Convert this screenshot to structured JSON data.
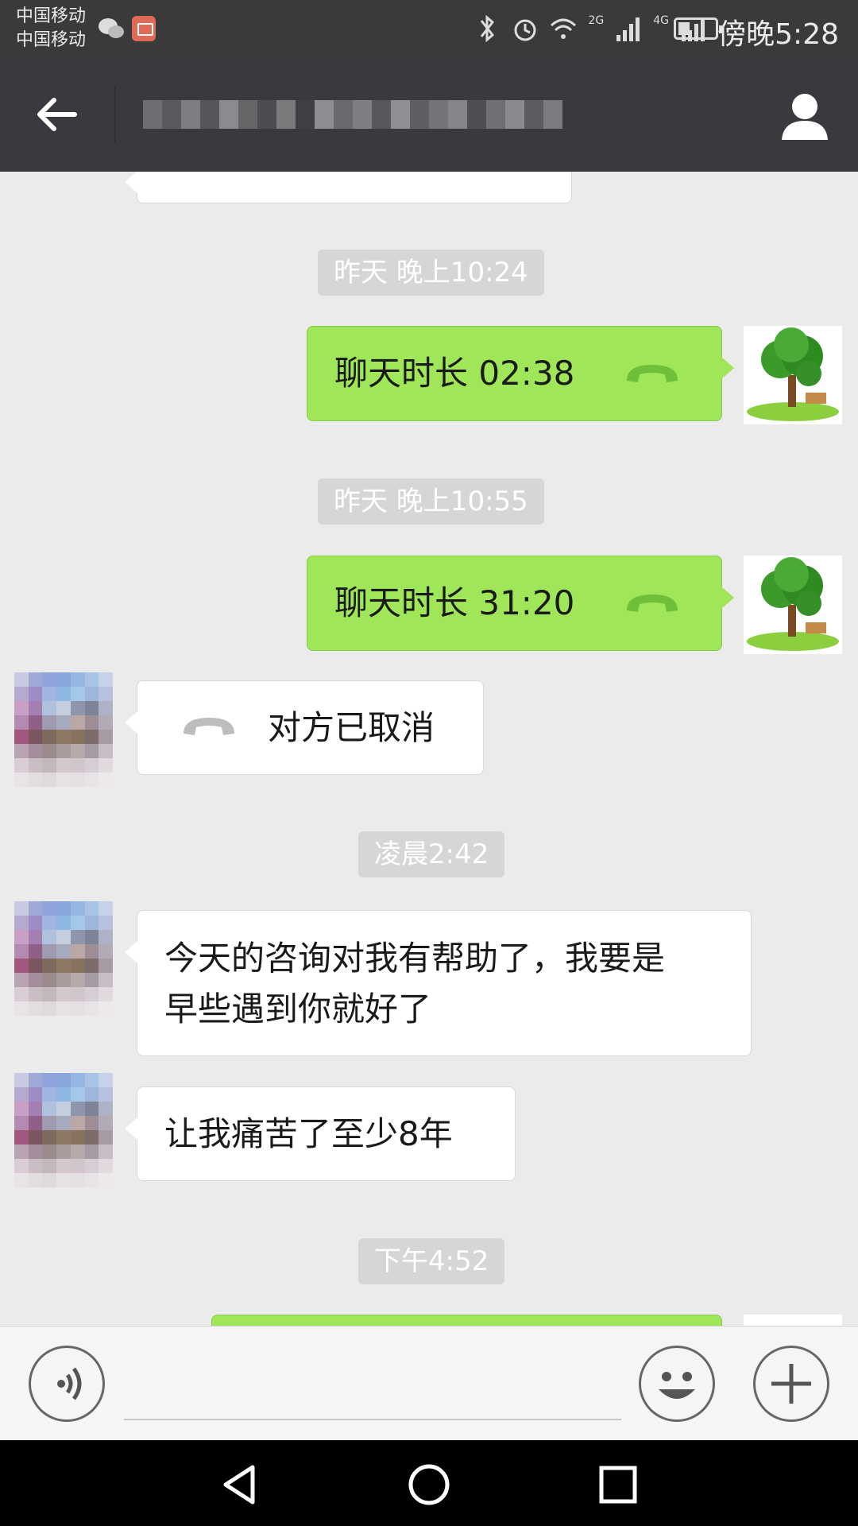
{
  "status_bar": {
    "carrier_1": "中国移动",
    "carrier_2": "中国移动",
    "net_a": "2G",
    "net_b": "4G",
    "time": "傍晚5:28"
  },
  "header": {
    "title": "",
    "back_icon": "arrow-left-icon",
    "profile_icon": "user-icon"
  },
  "messages": [
    {
      "kind": "time",
      "text": "昨天 晚上10:24"
    },
    {
      "kind": "call",
      "side": "me",
      "text": "聊天时长 02:38"
    },
    {
      "kind": "time",
      "text": "昨天 晚上10:55"
    },
    {
      "kind": "call",
      "side": "me",
      "text": "聊天时长 31:20"
    },
    {
      "kind": "call",
      "side": "them",
      "text": "对方已取消"
    },
    {
      "kind": "time",
      "text": "凌晨2:42"
    },
    {
      "kind": "text",
      "side": "them",
      "text": "今天的咨询对我有帮助了，我要是\n早些遇到你就好了"
    },
    {
      "kind": "text",
      "side": "them",
      "text": "让我痛苦了至少8年"
    },
    {
      "kind": "time",
      "text": "下午4:52"
    }
  ],
  "input": {
    "placeholder": "",
    "value": ""
  },
  "colors": {
    "my_bubble": "#9fe658",
    "their_bubble": "#ffffff",
    "header": "#393a3e",
    "call_icon": "#6fbf3a"
  },
  "icons": {
    "voice": "voice-icon",
    "emoji": "emoji-icon",
    "plus": "plus-icon"
  }
}
